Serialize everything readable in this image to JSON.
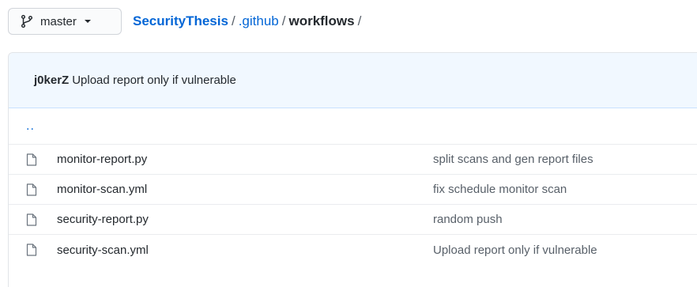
{
  "branch": {
    "label": "master",
    "icon": "git-branch-icon"
  },
  "breadcrumb": {
    "repo": "SecurityThesis",
    "separator": "/",
    "folder": ".github",
    "current": "workflows",
    "trailing": "/"
  },
  "latest_commit": {
    "author": "j0kerZ",
    "message": "Upload report only if vulnerable"
  },
  "parent_dir": "..",
  "files": [
    {
      "name": "monitor-report.py",
      "message": "split scans and gen report files"
    },
    {
      "name": "monitor-scan.yml",
      "message": "fix schedule monitor scan"
    },
    {
      "name": "security-report.py",
      "message": "random push"
    },
    {
      "name": "security-scan.yml",
      "message": "Upload report only if vulnerable"
    }
  ],
  "colors": {
    "link": "#0366d6",
    "header_bg": "#f1f8ff",
    "text": "#24292e",
    "muted": "#586069"
  }
}
